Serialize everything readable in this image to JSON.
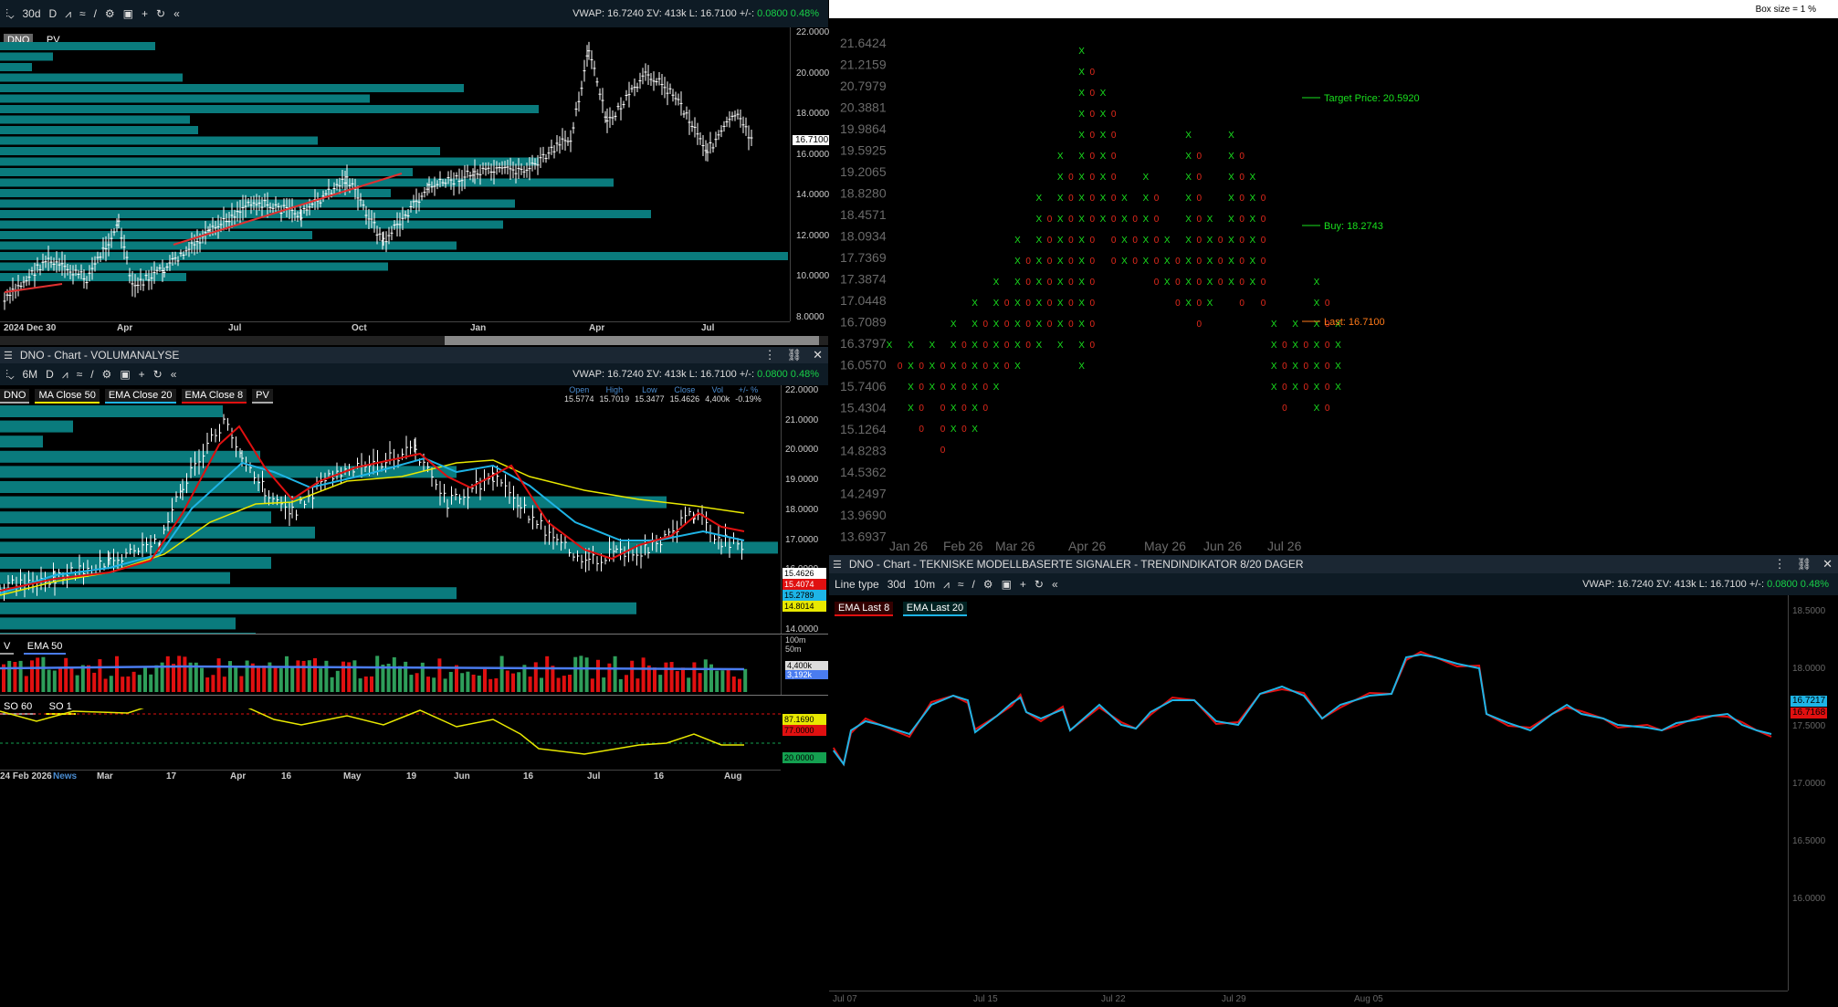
{
  "top_chart": {
    "toolbar": {
      "interval": "30d",
      "period": "D"
    },
    "vwap": {
      "vwap": "VWAP: 16.7240",
      "volume": "ΣV: 413k",
      "last": "L: 16.7100",
      "change_label": "+/-:",
      "change": "0.0800",
      "change_pct": "0.48%"
    },
    "legend": [
      "DNO",
      "PV"
    ],
    "price_axis": [
      "22.0000",
      "20.0000",
      "18.0000",
      "16.0000",
      "14.0000",
      "12.0000",
      "10.0000",
      "8.0000"
    ],
    "last_price": "16.7100",
    "date_axis": [
      "2024 Dec 30",
      "Apr",
      "Jul",
      "Oct",
      "Jan",
      "Apr",
      "Jul"
    ]
  },
  "mid_chart": {
    "title": "DNO - Chart - VOLUMANALYSE",
    "toolbar": {
      "interval": "6M",
      "period": "D"
    },
    "vwap": {
      "vwap": "VWAP: 16.7240",
      "volume": "ΣV: 413k",
      "last": "L: 16.7100",
      "change_label": "+/-:",
      "change": "0.0800",
      "change_pct": "0.48%"
    },
    "legend": [
      {
        "label": "DNO",
        "color": "#aaaaaa"
      },
      {
        "label": "MA  Close 50",
        "color": "#e8e800"
      },
      {
        "label": "EMA  Close 20",
        "color": "#1eb4e6"
      },
      {
        "label": "EMA  Close 8",
        "color": "#e01010"
      },
      {
        "label": "PV",
        "color": "#aaaaaa"
      }
    ],
    "ohlc": {
      "headers": [
        "Open",
        "High",
        "Low",
        "Close",
        "Vol",
        "+/- %"
      ],
      "values": [
        "15.5774",
        "15.7019",
        "15.3477",
        "15.4626",
        "4,400k",
        "-0.19%"
      ]
    },
    "price_axis": [
      "22.0000",
      "21.0000",
      "20.0000",
      "19.0000",
      "18.0000",
      "17.0000",
      "16.0000",
      "15.0000",
      "14.0000"
    ],
    "price_boxes": [
      {
        "value": "15.4626",
        "color": "#ffffff",
        "text": "#000"
      },
      {
        "value": "15.4074",
        "color": "#e01010",
        "text": "#fff"
      },
      {
        "value": "15.2789",
        "color": "#1eb4e6",
        "text": "#000"
      },
      {
        "value": "14.8014",
        "color": "#e8e800",
        "text": "#000"
      }
    ],
    "vol_legend": [
      "V",
      "EMA  50"
    ],
    "vol_axis": [
      "100m",
      "50m"
    ],
    "vol_boxes": [
      "4,400k",
      "3,192k"
    ],
    "so_legend": [
      "SO  60",
      "SO  1"
    ],
    "so_boxes": [
      {
        "value": "87.1690",
        "color": "#e8e800"
      },
      {
        "value": "77.0000",
        "color": "#e01010"
      },
      {
        "value": "20.0000",
        "color": "#14a050"
      }
    ],
    "date_axis": [
      "24 Feb 2026",
      "News",
      "Mar",
      "17",
      "Apr",
      "16",
      "May",
      "19",
      "Jun",
      "16",
      "Jul",
      "16",
      "Aug"
    ]
  },
  "pf_chart": {
    "box_size": "Box size = 1 %",
    "price_axis": [
      "21.6424",
      "21.2159",
      "20.7979",
      "20.3881",
      "19.9864",
      "19.5925",
      "19.2065",
      "18.8280",
      "18.4571",
      "18.0934",
      "17.7369",
      "17.3874",
      "17.0448",
      "16.7089",
      "16.3797",
      "16.0570",
      "15.7406",
      "15.4304",
      "15.1264",
      "14.8283",
      "14.5362",
      "14.2497",
      "13.9690",
      "13.6937"
    ],
    "date_axis": [
      "Jan 26",
      "Feb 26",
      "Mar 26",
      "Apr 26",
      "May 26",
      "Jun 26",
      "Jul 26"
    ],
    "target": "Target Price: 20.5920",
    "buy": "Buy: 18.2743",
    "last": "Last: 16.7100"
  },
  "trend_chart": {
    "title": "DNO - Chart - TEKNISKE MODELLBASERTE SIGNALER - TRENDINDIKATOR 8/20 DAGER",
    "toolbar": {
      "line_type": "Line type",
      "interval": "30d",
      "sub": "10m"
    },
    "vwap": {
      "vwap": "VWAP: 16.7240",
      "volume": "ΣV: 413k",
      "last": "L: 16.7100",
      "change_label": "+/-:",
      "change": "0.0800",
      "change_pct": "0.48%"
    },
    "legend": [
      {
        "label": "EMA  Last 8",
        "color": "#e01010"
      },
      {
        "label": "EMA  Last 20",
        "color": "#1eb4e6"
      }
    ],
    "price_axis": [
      "18.5000",
      "18.0000",
      "17.5000",
      "17.0000",
      "16.5000",
      "16.0000"
    ],
    "boxes": [
      {
        "value": "16.7217",
        "color": "#1eb4e6"
      },
      {
        "value": "16.7168",
        "color": "#e01010"
      }
    ],
    "date_axis": [
      "Jul 07",
      "Jul 15",
      "Jul 22",
      "Jul 29",
      "Aug 05"
    ]
  }
}
